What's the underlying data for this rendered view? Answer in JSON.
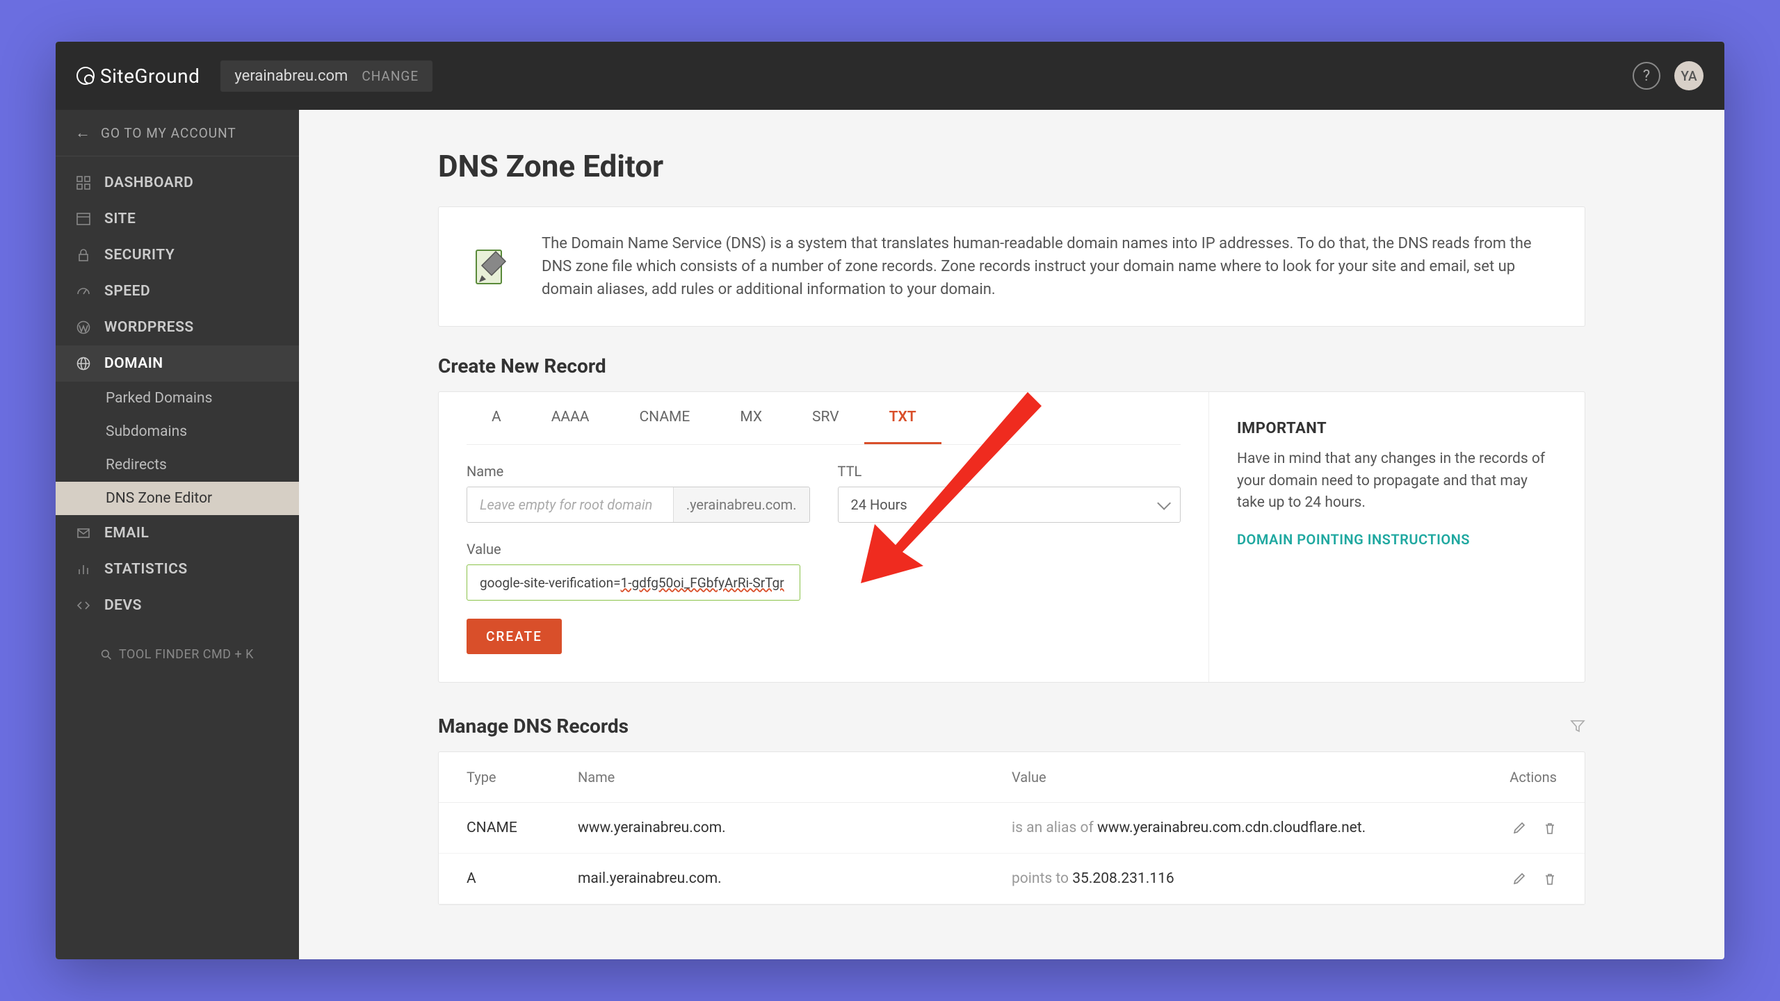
{
  "topbar": {
    "logo_text": "SiteGround",
    "domain": "yerainabreu.com",
    "change_label": "CHANGE",
    "avatar_initials": "YA"
  },
  "sidebar": {
    "goto_label": "GO TO MY ACCOUNT",
    "items": [
      {
        "label": "DASHBOARD",
        "icon": "grid"
      },
      {
        "label": "SITE",
        "icon": "window"
      },
      {
        "label": "SECURITY",
        "icon": "lock"
      },
      {
        "label": "SPEED",
        "icon": "gauge"
      },
      {
        "label": "WORDPRESS",
        "icon": "wp"
      },
      {
        "label": "DOMAIN",
        "icon": "globe",
        "active": true
      },
      {
        "label": "EMAIL",
        "icon": "mail"
      },
      {
        "label": "STATISTICS",
        "icon": "chart"
      },
      {
        "label": "DEVS",
        "icon": "code"
      }
    ],
    "domain_sub": [
      {
        "label": "Parked Domains"
      },
      {
        "label": "Subdomains"
      },
      {
        "label": "Redirects"
      },
      {
        "label": "DNS Zone Editor",
        "active": true
      }
    ],
    "tool_finder": "TOOL FINDER CMD + K"
  },
  "page": {
    "title": "DNS Zone Editor",
    "intro": "The Domain Name Service (DNS) is a system that translates human-readable domain names into IP addresses. To do that, the DNS reads from the DNS zone file which consists of a number of zone records. Zone records instruct your domain name where to look for your site and email, set up domain aliases, add rules or additional information to your domain."
  },
  "create": {
    "heading": "Create New Record",
    "tabs": [
      "A",
      "AAAA",
      "CNAME",
      "MX",
      "SRV",
      "TXT"
    ],
    "active_tab": "TXT",
    "name_label": "Name",
    "name_placeholder": "Leave empty for root domain",
    "name_suffix": ".yerainabreu.com.",
    "ttl_label": "TTL",
    "ttl_value": "24 Hours",
    "value_label": "Value",
    "value_text": "google-site-verification=1-gdfg50oi_FGbfyArRi-SrTgr",
    "button": "CREATE"
  },
  "important": {
    "title": "IMPORTANT",
    "text": "Have in mind that any changes in the records of your domain need to propagate and that may take up to 24 hours.",
    "link": "DOMAIN POINTING INSTRUCTIONS"
  },
  "manage": {
    "heading": "Manage DNS Records",
    "headers": {
      "type": "Type",
      "name": "Name",
      "value": "Value",
      "actions": "Actions"
    },
    "rows": [
      {
        "type": "CNAME",
        "name": "www.yerainabreu.com.",
        "value_prefix": "is an alias of ",
        "value": "www.yerainabreu.com.cdn.cloudflare.net."
      },
      {
        "type": "A",
        "name": "mail.yerainabreu.com.",
        "value_prefix": "points to ",
        "value": "35.208.231.116"
      }
    ]
  }
}
